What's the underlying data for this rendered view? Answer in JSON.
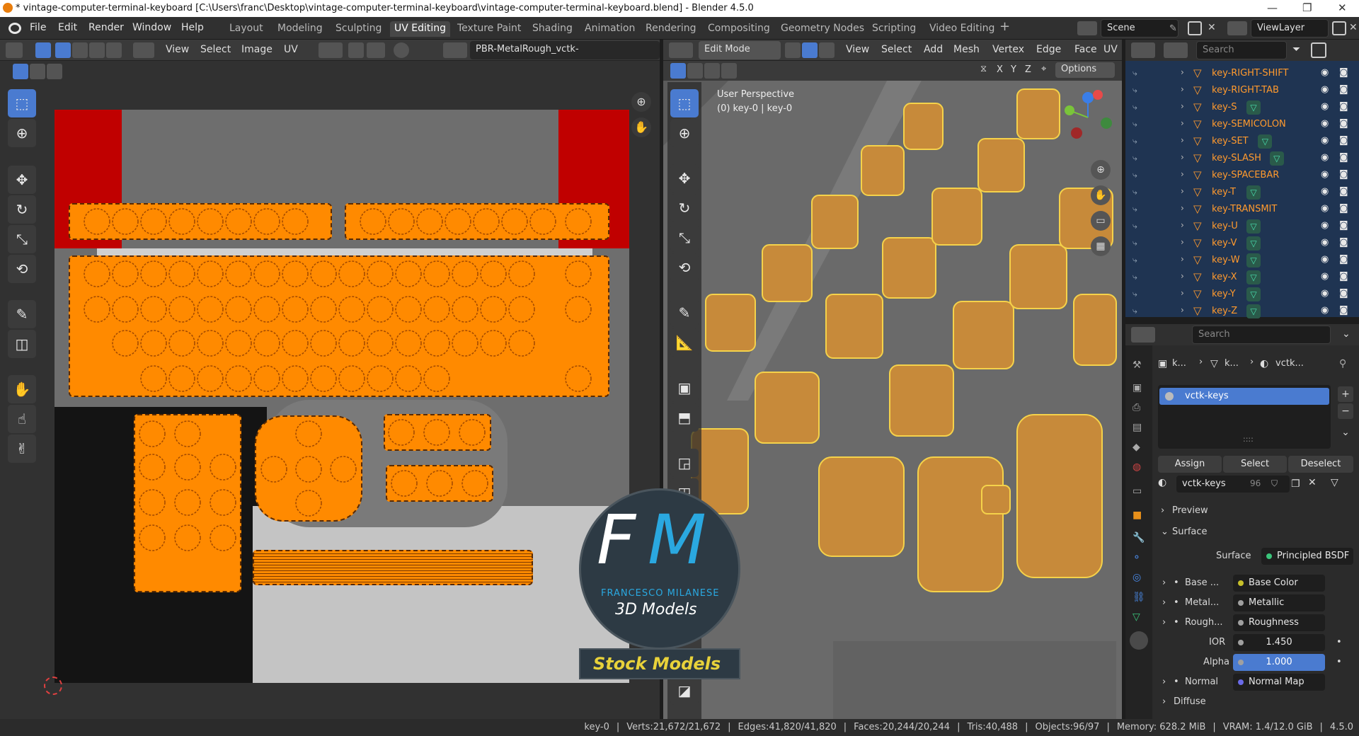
{
  "window": {
    "title": "* vintage-computer-terminal-keyboard [C:\\Users\\franc\\Desktop\\vintage-computer-terminal-keyboard\\vintage-computer-terminal-keyboard.blend] - Blender 4.5.0",
    "controls": [
      "—",
      "❐",
      "✕"
    ]
  },
  "menu": [
    "File",
    "Edit",
    "Render",
    "Window",
    "Help"
  ],
  "workspaces": [
    {
      "label": "Layout",
      "active": false
    },
    {
      "label": "Modeling",
      "active": false
    },
    {
      "label": "Sculpting",
      "active": false
    },
    {
      "label": "UV Editing",
      "active": true
    },
    {
      "label": "Texture Paint",
      "active": false
    },
    {
      "label": "Shading",
      "active": false
    },
    {
      "label": "Animation",
      "active": false
    },
    {
      "label": "Rendering",
      "active": false
    },
    {
      "label": "Compositing",
      "active": false
    },
    {
      "label": "Geometry Nodes",
      "active": false
    },
    {
      "label": "Scripting",
      "active": false
    },
    {
      "label": "Video Editing",
      "active": false
    }
  ],
  "add_workspace": "+",
  "scene": "Scene",
  "view_layer": "ViewLayer",
  "uv_editor": {
    "menus": [
      "View",
      "Select",
      "Image",
      "UV"
    ],
    "image_name": "PBR-MetalRough_vctk-keys_BaseColor.p"
  },
  "viewport": {
    "mode": "Edit Mode",
    "menus": [
      "View",
      "Select",
      "Add",
      "Mesh",
      "Vertex",
      "Edge",
      "Face",
      "UV"
    ],
    "axes": [
      "X",
      "Y",
      "Z"
    ],
    "options": "Options",
    "perspective": "User Perspective",
    "object_info": "(0) key-0 | key-0"
  },
  "outliner": {
    "items": [
      {
        "label": "key-RIGHT-SHIFT",
        "mesh_badge": false
      },
      {
        "label": "key-RIGHT-TAB",
        "mesh_badge": false
      },
      {
        "label": "key-S",
        "mesh_badge": true
      },
      {
        "label": "key-SEMICOLON",
        "mesh_badge": false
      },
      {
        "label": "key-SET",
        "mesh_badge": true
      },
      {
        "label": "key-SLASH",
        "mesh_badge": true
      },
      {
        "label": "key-SPACEBAR",
        "mesh_badge": false
      },
      {
        "label": "key-T",
        "mesh_badge": true
      },
      {
        "label": "key-TRANSMIT",
        "mesh_badge": false
      },
      {
        "label": "key-U",
        "mesh_badge": true
      },
      {
        "label": "key-V",
        "mesh_badge": true
      },
      {
        "label": "key-W",
        "mesh_badge": true
      },
      {
        "label": "key-X",
        "mesh_badge": true
      },
      {
        "label": "key-Y",
        "mesh_badge": true
      },
      {
        "label": "key-Z",
        "mesh_badge": true
      }
    ]
  },
  "properties": {
    "search_placeholder": "Search",
    "breadcrumb": [
      "k...",
      "k...",
      "vctk..."
    ],
    "material_slot": "vctk-keys",
    "dots": "::::",
    "assign": "Assign",
    "select": "Select",
    "deselect": "Deselect",
    "material_name": "vctk-keys",
    "users": "96",
    "preview": "Preview",
    "surface_panel": "Surface",
    "surface_label": "Surface",
    "surface_value": "Principled BSDF",
    "inputs": [
      {
        "label": "Base ...",
        "value": "Base Color",
        "color": "#c7c02a"
      },
      {
        "label": "Metal...",
        "value": "Metallic",
        "color": "#a0a0a0"
      },
      {
        "label": "Rough...",
        "value": "Roughness",
        "color": "#a0a0a0"
      }
    ],
    "ior_label": "IOR",
    "ior_value": "1.450",
    "alpha_label": "Alpha",
    "alpha_value": "1.000",
    "normal_label": "Normal",
    "normal_value": "Normal Map",
    "diffuse": "Diffuse"
  },
  "status": {
    "object": "key-0",
    "verts": "Verts:21,672/21,672",
    "edges": "Edges:41,820/41,820",
    "faces": "Faces:20,244/20,244",
    "tris": "Tris:40,488",
    "objects": "Objects:96/97",
    "memory": "Memory: 628.2 MiB",
    "vram": "VRAM: 1.4/12.0 GiB",
    "version": "4.5.0"
  },
  "watermark": {
    "logo_f": "F",
    "logo_m": "M",
    "brand": "FRANCESCO MILANESE",
    "subtitle": "3D Models",
    "banner": "Stock Models"
  },
  "colors": {
    "accent": "#4a7bd0",
    "uv_island": "#ff8a00",
    "uv_red": "#c00000",
    "selected_wire": "#f5d24a"
  }
}
